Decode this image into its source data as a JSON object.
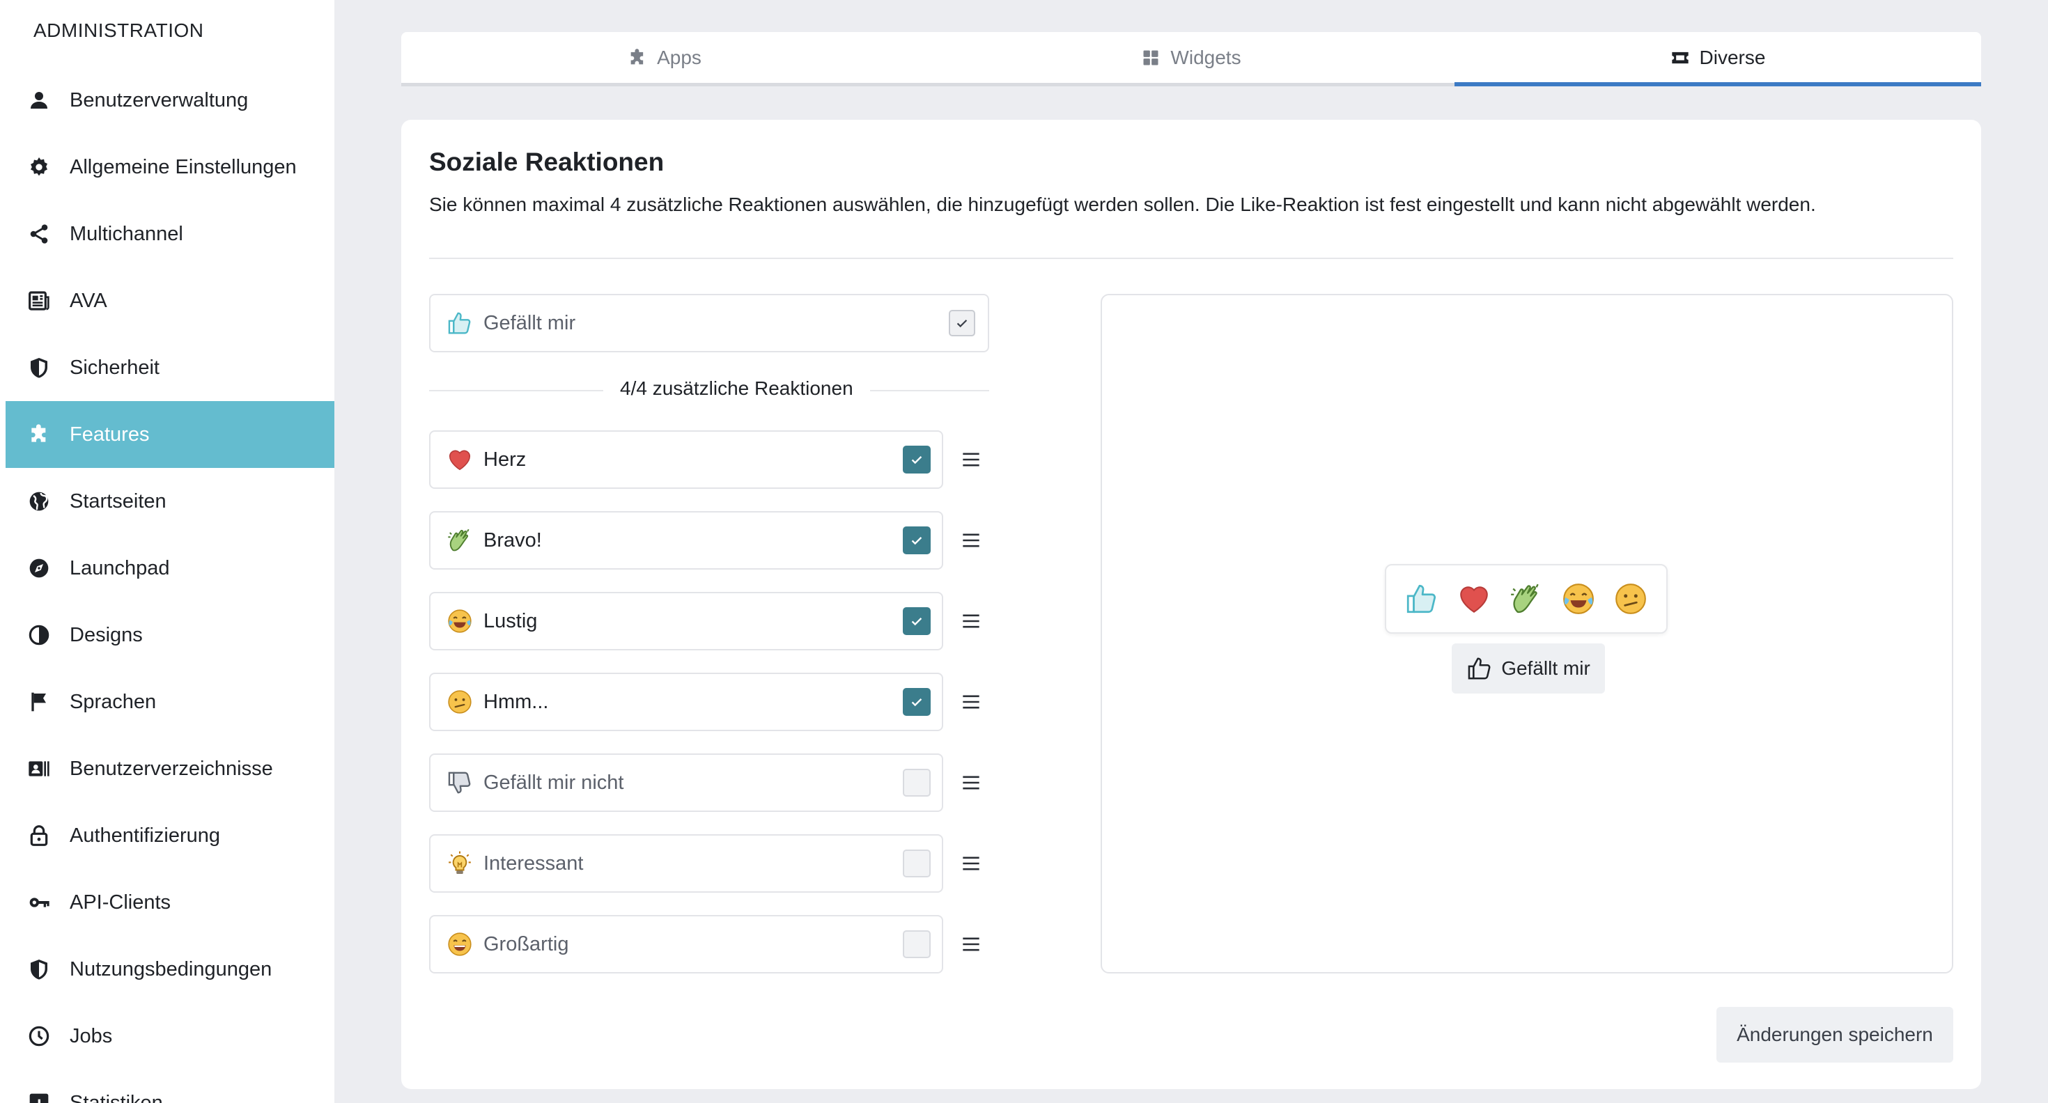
{
  "sidebar": {
    "heading": "ADMINISTRATION",
    "items": [
      {
        "label": "Benutzerverwaltung",
        "icon": "user-icon"
      },
      {
        "label": "Allgemeine Einstellungen",
        "icon": "gear-icon"
      },
      {
        "label": "Multichannel",
        "icon": "share-icon"
      },
      {
        "label": "AVA",
        "icon": "newspaper-icon"
      },
      {
        "label": "Sicherheit",
        "icon": "shield-icon"
      },
      {
        "label": "Features",
        "icon": "puzzle-icon",
        "active": true
      },
      {
        "label": "Startseiten",
        "icon": "globe-icon"
      },
      {
        "label": "Launchpad",
        "icon": "compass-icon"
      },
      {
        "label": "Designs",
        "icon": "contrast-icon"
      },
      {
        "label": "Sprachen",
        "icon": "flag-icon"
      },
      {
        "label": "Benutzerverzeichnisse",
        "icon": "address-card-icon"
      },
      {
        "label": "Authentifizierung",
        "icon": "lock-icon"
      },
      {
        "label": "API-Clients",
        "icon": "key-icon"
      },
      {
        "label": "Nutzungsbedingungen",
        "icon": "shield-icon"
      },
      {
        "label": "Jobs",
        "icon": "clock-icon"
      },
      {
        "label": "Statistiken",
        "icon": "chart-icon"
      }
    ]
  },
  "tabs": [
    {
      "label": "Apps",
      "icon": "puzzle-icon"
    },
    {
      "label": "Widgets",
      "icon": "grid-icon"
    },
    {
      "label": "Diverse",
      "icon": "ticket-icon",
      "active": true
    }
  ],
  "card": {
    "title": "Soziale Reaktionen",
    "description": "Sie können maximal 4 zusätzliche Reaktionen auswählen, die hinzugefügt werden sollen. Die Like-Reaktion ist fest eingestellt und kann nicht abgewählt werden.",
    "fixed_reaction": {
      "label": "Gefällt mir",
      "icon": "thumbs-up-icon",
      "checked": true
    },
    "counter": "4/4 zusätzliche Reaktionen",
    "reactions": [
      {
        "label": "Herz",
        "icon": "heart-icon",
        "checked": true
      },
      {
        "label": "Bravo!",
        "icon": "clapping-hands-icon",
        "checked": true
      },
      {
        "label": "Lustig",
        "icon": "laughing-face-icon",
        "checked": true
      },
      {
        "label": "Hmm...",
        "icon": "confused-face-icon",
        "checked": true
      },
      {
        "label": "Gefällt mir nicht",
        "icon": "thumbs-down-icon",
        "checked": false
      },
      {
        "label": "Interessant",
        "icon": "lightbulb-icon",
        "checked": false
      },
      {
        "label": "Großartig",
        "icon": "grinning-face-icon",
        "checked": false
      }
    ],
    "preview": {
      "popup_icons": [
        "thumbs-up-icon",
        "heart-icon",
        "clapping-hands-icon",
        "laughing-face-icon",
        "confused-face-icon"
      ],
      "like_button_label": "Gefällt mir"
    },
    "save_label": "Änderungen speichern"
  },
  "colors": {
    "accent": "#64bccf",
    "checkbox_checked": "#3b7d8c",
    "tab_active_underline": "#3c7ac4",
    "background": "#ecedf1"
  }
}
